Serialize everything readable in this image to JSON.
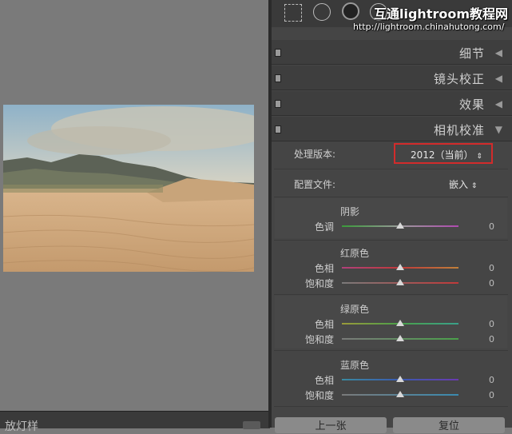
{
  "watermark": {
    "title": "互通lightroom教程网",
    "url": "http://lightroom.chinahutong.com/"
  },
  "left": {
    "bottom_label": "放灯样"
  },
  "panels": {
    "detail": "细节",
    "lens": "镜头校正",
    "effects": "效果",
    "calibration": "相机校准"
  },
  "calibration": {
    "process_label": "处理版本:",
    "process_value": "2012（当前）",
    "profile_label": "配置文件:",
    "profile_value": "嵌入",
    "shadows": {
      "title": "阴影",
      "tint_label": "色调",
      "tint_value": "0"
    },
    "red": {
      "title": "红原色",
      "hue_label": "色相",
      "hue_value": "0",
      "sat_label": "饱和度",
      "sat_value": "0"
    },
    "green": {
      "title": "绿原色",
      "hue_label": "色相",
      "hue_value": "0",
      "sat_label": "饱和度",
      "sat_value": "0"
    },
    "blue": {
      "title": "蓝原色",
      "hue_label": "色相",
      "hue_value": "0",
      "sat_label": "饱和度",
      "sat_value": "0"
    }
  },
  "footer": {
    "prev": "上一张",
    "reset": "复位"
  },
  "colors": {
    "accent_red": "#d22b2b"
  }
}
